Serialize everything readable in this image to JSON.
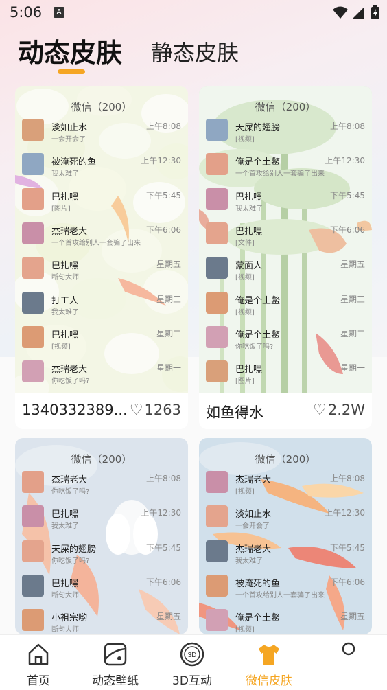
{
  "status_bar": {
    "time": "5:06",
    "a_icon": "A"
  },
  "tabs": [
    {
      "label": "动态皮肤",
      "active": true
    },
    {
      "label": "静态皮肤",
      "active": false
    }
  ],
  "accent_color": "#f5a623",
  "cards": [
    {
      "name": "1340332389...",
      "likes": "1263",
      "chat_title": "微信（200）",
      "background": "pebbles",
      "rows": [
        {
          "name": "淡如止水",
          "msg": "一会开会了",
          "time": "上午8:08"
        },
        {
          "name": "被淹死的鱼",
          "msg": "我太难了",
          "time": "上午12:30"
        },
        {
          "name": "巴扎嘿",
          "msg": "[图片]",
          "time": "下午5:45"
        },
        {
          "name": "杰瑞老大",
          "msg": "一个首攻给别人一套骗了出来",
          "time": "下午6:06"
        },
        {
          "name": "巴扎嘿",
          "msg": "断句大师",
          "time": "星期五"
        },
        {
          "name": "打工人",
          "msg": "我太难了",
          "time": "星期三"
        },
        {
          "name": "巴扎嘿",
          "msg": "[视频]",
          "time": "星期二"
        },
        {
          "name": "杰瑞老大",
          "msg": "你吃饭了吗?",
          "time": "星期一"
        }
      ]
    },
    {
      "name": "如鱼得水",
      "likes": "2.2W",
      "chat_title": "微信（200）",
      "background": "bamboo",
      "rows": [
        {
          "name": "天屎的翅膀",
          "msg": "[视频]",
          "time": "上午8:08"
        },
        {
          "name": "俺是个土鳖",
          "msg": "一个首攻给别人一套骗了出来",
          "time": "上午12:30"
        },
        {
          "name": "巴扎嘿",
          "msg": "我太难了",
          "time": "下午5:45"
        },
        {
          "name": "巴扎嘿",
          "msg": "[文件]",
          "time": "下午6:06"
        },
        {
          "name": "蒙面人",
          "msg": "[视频]",
          "time": "星期五"
        },
        {
          "name": "俺是个土鳖",
          "msg": "[视频]",
          "time": "星期三"
        },
        {
          "name": "俺是个土鳖",
          "msg": "你吃饭了吗?",
          "time": "星期二"
        },
        {
          "name": "巴扎嘿",
          "msg": "[图片]",
          "time": "星期一"
        }
      ]
    },
    {
      "name": "",
      "likes": "",
      "chat_title": "微信（200）",
      "background": "lotus",
      "rows": [
        {
          "name": "杰瑞老大",
          "msg": "你吃饭了吗?",
          "time": "上午8:08"
        },
        {
          "name": "巴扎嘿",
          "msg": "我太难了",
          "time": "上午12:30"
        },
        {
          "name": "天屎的翅膀",
          "msg": "你吃饭了吗?",
          "time": "下午5:45"
        },
        {
          "name": "巴扎嘿",
          "msg": "断句大师",
          "time": "下午6:06"
        },
        {
          "name": "小祖宗哟",
          "msg": "断句大师",
          "time": "星期五"
        }
      ]
    },
    {
      "name": "",
      "likes": "",
      "chat_title": "微信（200）",
      "background": "koi",
      "rows": [
        {
          "name": "杰瑞老大",
          "msg": "[视频]",
          "time": "上午8:08"
        },
        {
          "name": "淡如止水",
          "msg": "一会开会了",
          "time": "上午12:30"
        },
        {
          "name": "杰瑞老大",
          "msg": "我太难了",
          "time": "下午5:45"
        },
        {
          "name": "被淹死的鱼",
          "msg": "一个首攻给别人一套骗了出来",
          "time": "下午6:06"
        },
        {
          "name": "俺是个土鳖",
          "msg": "[视频]",
          "time": "星期五"
        }
      ]
    }
  ],
  "nav": [
    {
      "label": "首页",
      "icon": "home-icon",
      "active": false
    },
    {
      "label": "动态壁纸",
      "icon": "wallpaper-icon",
      "active": false
    },
    {
      "label": "3D互动",
      "icon": "3d-icon",
      "active": false
    },
    {
      "label": "微信皮肤",
      "icon": "tshirt-icon",
      "active": true
    },
    {
      "label": "",
      "icon": "circle-icon",
      "active": false
    }
  ],
  "nav_3d_glyph": "3D"
}
